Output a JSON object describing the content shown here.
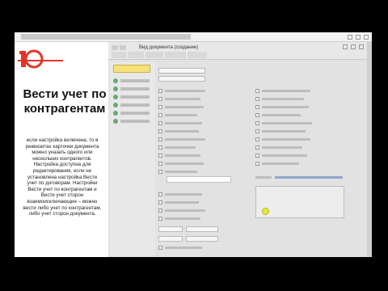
{
  "slide": {
    "logo_text": "1С",
    "title": "Вести учет по контрагентам",
    "body": "если настройка включена, то в реквизитах карточки документа можно указать одного или нескольких контрагентов. Настройка доступна для редактирования, если не установлена настройка Вести учет по договорам. Настройки Вести учет по контрагентам и Вести учет сторон взаимоисключающие – можно вести либо учет по контрагентам, либо учет сторон документа."
  },
  "app": {
    "title": "Вид документа (создание)"
  },
  "colors": {
    "logo_red": "#e4342a",
    "save_yellow": "#f7e27a",
    "cursor_yellow": "#e4ea3c"
  }
}
